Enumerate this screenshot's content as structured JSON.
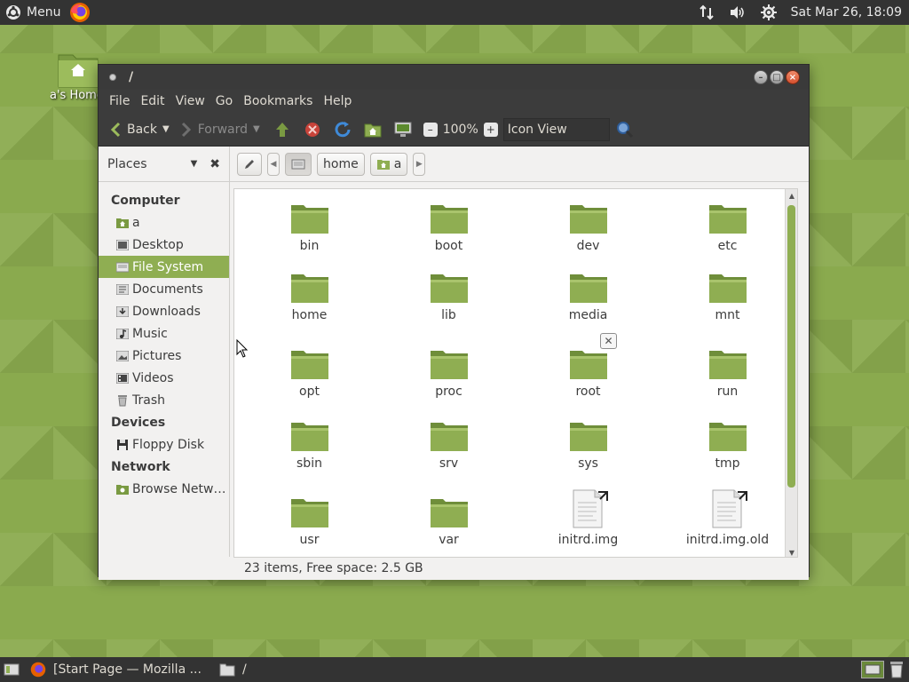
{
  "top_panel": {
    "menu_label": "Menu",
    "clock": "Sat Mar 26, 18:09"
  },
  "desktop": {
    "home_icon_label": "a's Home"
  },
  "window": {
    "title": "/",
    "menubar": [
      "File",
      "Edit",
      "View",
      "Go",
      "Bookmarks",
      "Help"
    ],
    "toolbar": {
      "back": "Back",
      "forward": "Forward",
      "zoom": "100%",
      "view_mode": "Icon View"
    },
    "location": {
      "places_label": "Places",
      "crumbs": [
        "home",
        "a"
      ]
    },
    "sidebar": {
      "computer_header": "Computer",
      "computer_items": [
        "a",
        "Desktop",
        "File System",
        "Documents",
        "Downloads",
        "Music",
        "Pictures",
        "Videos",
        "Trash"
      ],
      "selected": "File System",
      "devices_header": "Devices",
      "devices_items": [
        "Floppy Disk"
      ],
      "network_header": "Network",
      "network_items": [
        "Browse Netw…"
      ]
    },
    "files": [
      {
        "name": "bin",
        "type": "folder"
      },
      {
        "name": "boot",
        "type": "folder"
      },
      {
        "name": "dev",
        "type": "folder"
      },
      {
        "name": "etc",
        "type": "folder"
      },
      {
        "name": "home",
        "type": "folder"
      },
      {
        "name": "lib",
        "type": "folder"
      },
      {
        "name": "media",
        "type": "folder"
      },
      {
        "name": "mnt",
        "type": "folder"
      },
      {
        "name": "opt",
        "type": "folder"
      },
      {
        "name": "proc",
        "type": "folder"
      },
      {
        "name": "root",
        "type": "folder"
      },
      {
        "name": "run",
        "type": "folder"
      },
      {
        "name": "sbin",
        "type": "folder"
      },
      {
        "name": "srv",
        "type": "folder"
      },
      {
        "name": "sys",
        "type": "folder"
      },
      {
        "name": "tmp",
        "type": "folder"
      },
      {
        "name": "usr",
        "type": "folder"
      },
      {
        "name": "var",
        "type": "folder"
      },
      {
        "name": "initrd.img",
        "type": "link"
      },
      {
        "name": "initrd.img.old",
        "type": "link"
      }
    ],
    "status": "23 items, Free space: 2.5 GB"
  },
  "bottom_panel": {
    "tasks": [
      "[Start Page — Mozilla ...",
      "/"
    ]
  },
  "colors": {
    "accent": "#8fae52",
    "panel": "#333333",
    "folder": "#8fae52"
  }
}
